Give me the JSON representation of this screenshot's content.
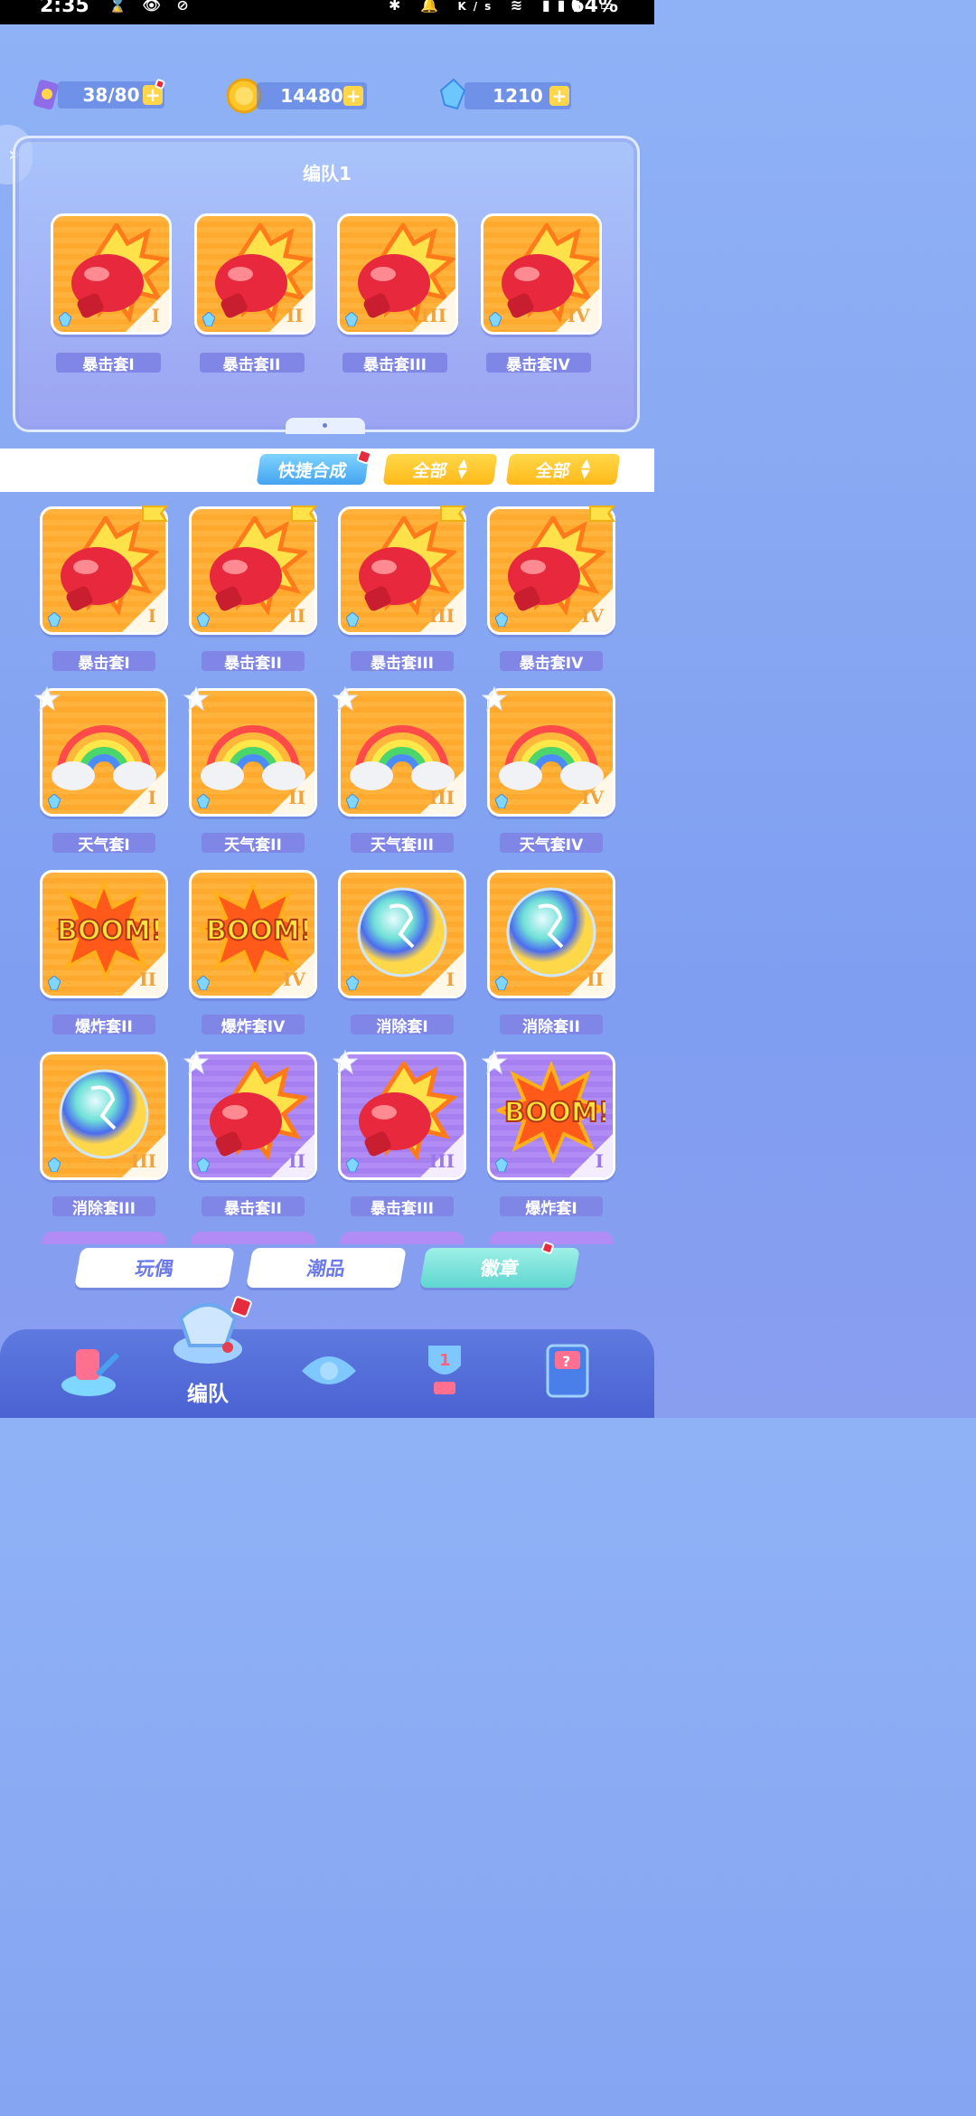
{
  "status_bar": {
    "time": "2:35",
    "battery": "64%",
    "net_unit": "K/s"
  },
  "resources": [
    {
      "name": "ticket-resource",
      "value": "38/80",
      "color": "#8f6de8"
    },
    {
      "name": "coin-resource",
      "value": "14480",
      "color": "#ffc629"
    },
    {
      "name": "crystal-resource",
      "value": "1210",
      "color": "#6ec6ff"
    }
  ],
  "team": {
    "title": "编队1",
    "slots": [
      {
        "label": "暴击套I",
        "numeral": "I"
      },
      {
        "label": "暴击套II",
        "numeral": "II"
      },
      {
        "label": "暴击套III",
        "numeral": "III"
      },
      {
        "label": "暴击套IV",
        "numeral": "IV"
      }
    ]
  },
  "toolbar": {
    "quick_compose": "快捷合成",
    "filter1": "全部",
    "filter2": "全部"
  },
  "badges": [
    {
      "label": "暴击套I",
      "numeral": "I",
      "art": "glove",
      "bg": "orange",
      "mark": "flag"
    },
    {
      "label": "暴击套II",
      "numeral": "II",
      "art": "glove",
      "bg": "orange",
      "mark": "flag"
    },
    {
      "label": "暴击套III",
      "numeral": "III",
      "art": "glove",
      "bg": "orange",
      "mark": "flag"
    },
    {
      "label": "暴击套IV",
      "numeral": "IV",
      "art": "glove",
      "bg": "orange",
      "mark": "flag"
    },
    {
      "label": "天气套I",
      "numeral": "I",
      "art": "rainbow",
      "bg": "orange",
      "mark": "star"
    },
    {
      "label": "天气套II",
      "numeral": "II",
      "art": "rainbow",
      "bg": "orange",
      "mark": "star"
    },
    {
      "label": "天气套III",
      "numeral": "III",
      "art": "rainbow",
      "bg": "orange",
      "mark": "star"
    },
    {
      "label": "天气套IV",
      "numeral": "IV",
      "art": "rainbow",
      "bg": "orange",
      "mark": "star"
    },
    {
      "label": "爆炸套II",
      "numeral": "II",
      "art": "boom",
      "bg": "orange",
      "mark": ""
    },
    {
      "label": "爆炸套IV",
      "numeral": "IV",
      "art": "boom",
      "bg": "orange",
      "mark": ""
    },
    {
      "label": "消除套I",
      "numeral": "I",
      "art": "orb",
      "bg": "orange",
      "mark": ""
    },
    {
      "label": "消除套II",
      "numeral": "II",
      "art": "orb",
      "bg": "orange",
      "mark": ""
    },
    {
      "label": "消除套III",
      "numeral": "III",
      "art": "orb",
      "bg": "orange",
      "mark": ""
    },
    {
      "label": "暴击套II",
      "numeral": "II",
      "art": "glove",
      "bg": "purple",
      "mark": "star"
    },
    {
      "label": "暴击套III",
      "numeral": "III",
      "art": "glove",
      "bg": "purple",
      "mark": "star"
    },
    {
      "label": "爆炸套I",
      "numeral": "I",
      "art": "boom",
      "bg": "purple",
      "mark": "star"
    }
  ],
  "categories": [
    {
      "label": "玩偶",
      "active": false
    },
    {
      "label": "潮品",
      "active": false
    },
    {
      "label": "徽章",
      "active": true
    }
  ],
  "nav": {
    "active_label": "编队"
  },
  "colors": {
    "accent_orange": "#ffb23c",
    "accent_purple": "#b18cf4",
    "label_bg": "#7f86e6",
    "active_tab": "#5fd6d0"
  }
}
